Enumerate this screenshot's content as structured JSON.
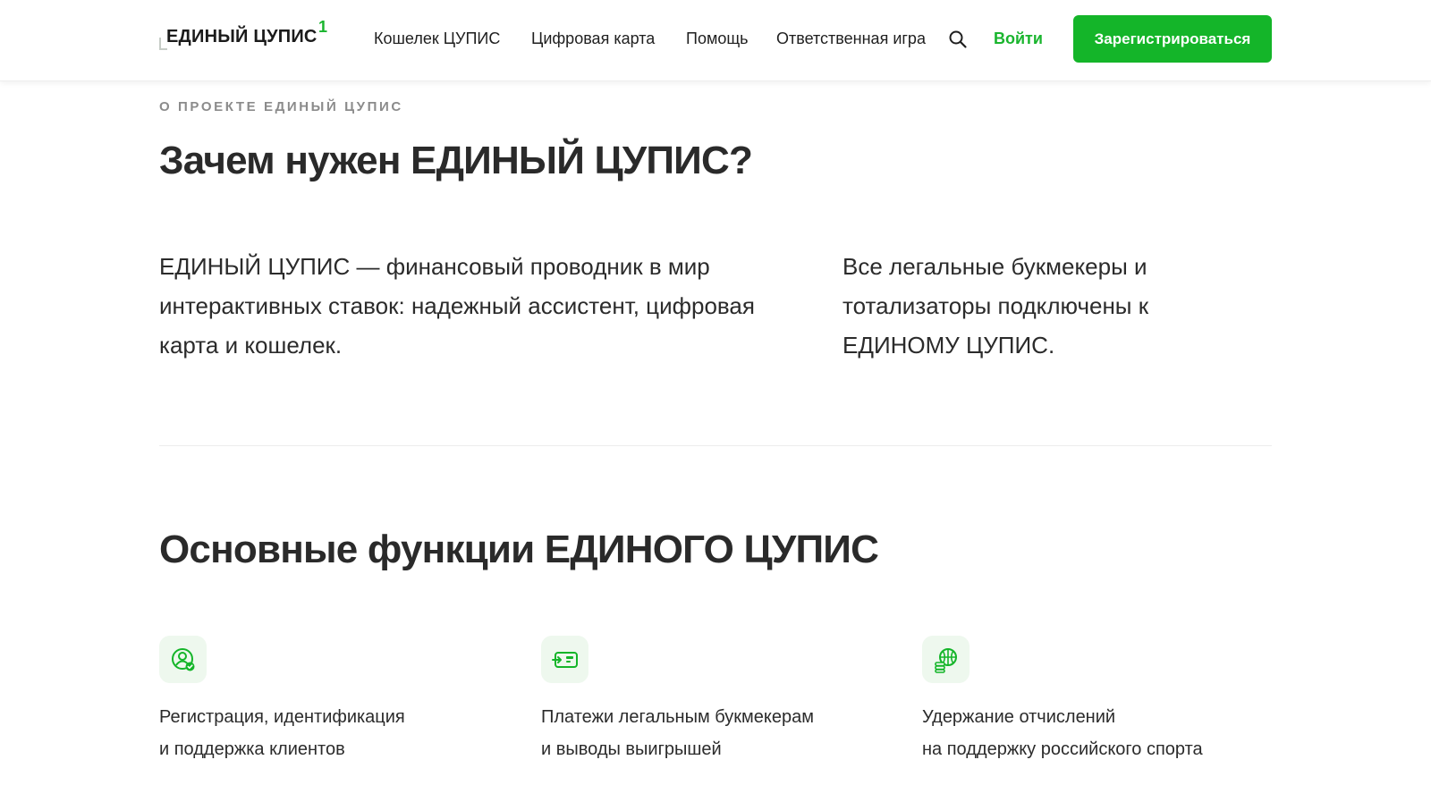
{
  "header": {
    "logo_text": "ЕДИНЫЙ ЦУПИС",
    "logo_superscript": "1",
    "nav": [
      "Кошелек ЦУПИС",
      "Цифровая карта",
      "Помощь",
      "Ответственная игра"
    ],
    "login_label": "Войти",
    "register_label": "Зарегистрироваться"
  },
  "about": {
    "eyebrow": "О ПРОЕКТЕ ЕДИНЫЙ ЦУПИС",
    "title": "Зачем нужен ЕДИНЫЙ ЦУПИС?",
    "left_text": "ЕДИНЫЙ ЦУПИС — финансовый проводник в мир интерактивных ставок: надежный ассистент, цифровая карта и кошелек.",
    "right_text": "Все легальные букмекеры и тотализаторы подключены к ЕДИНОМУ ЦУПИС."
  },
  "functions": {
    "title": "Основные функции ЕДИНОГО ЦУПИС",
    "items": [
      {
        "icon": "user-check-icon",
        "line1": "Регистрация, идентификация",
        "line2": "и поддержка клиентов"
      },
      {
        "icon": "payment-card-icon",
        "line1": "Платежи легальным букмекерам",
        "line2": "и выводы выигрышей"
      },
      {
        "icon": "ball-coins-icon",
        "line1": "Удержание отчислений",
        "line2": "на поддержку российского спорта"
      }
    ]
  },
  "colors": {
    "accent": "#14b529",
    "icon_bg": "#eef8ee",
    "text": "#2b2b2b",
    "muted": "#8b8b8b"
  }
}
